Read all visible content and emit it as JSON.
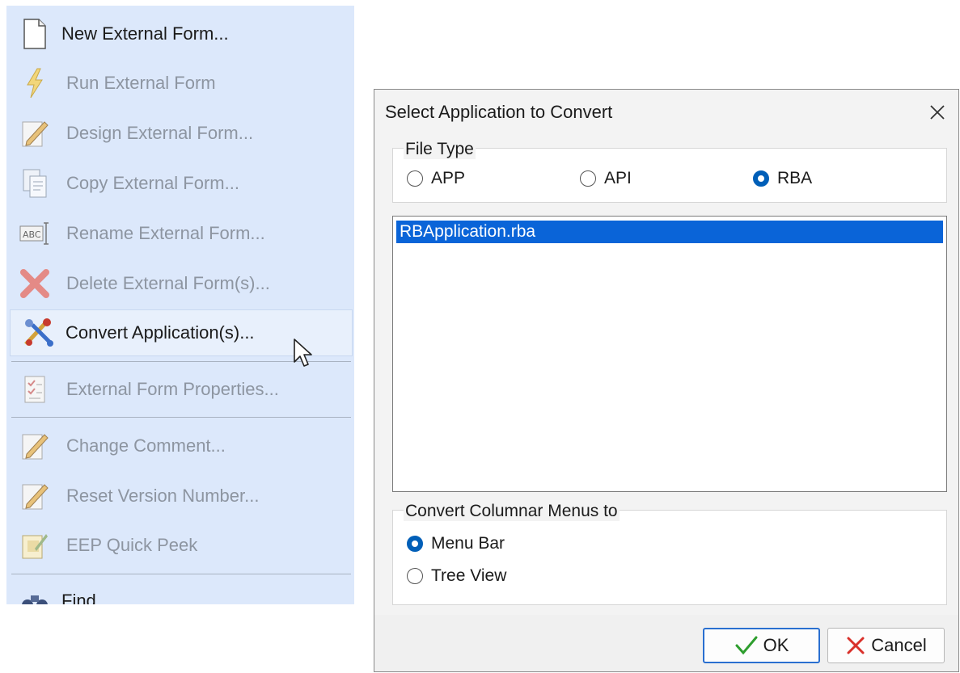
{
  "menu": {
    "items": [
      {
        "label": "New External Form...",
        "icon": "new-document-icon",
        "enabled": true
      },
      {
        "label": "Run External Form",
        "icon": "lightning-bolt-icon",
        "enabled": false
      },
      {
        "label": "Design External Form...",
        "icon": "design-pencil-icon",
        "enabled": false
      },
      {
        "label": "Copy External Form...",
        "icon": "copy-documents-icon",
        "enabled": false
      },
      {
        "label": "Rename External Form...",
        "icon": "rename-abc-icon",
        "enabled": false
      },
      {
        "label": "Delete External Form(s)...",
        "icon": "delete-x-icon",
        "enabled": false
      },
      {
        "label": "Convert Application(s)...",
        "icon": "convert-tools-icon",
        "enabled": true,
        "hovered": true
      },
      {
        "label": "External Form Properties...",
        "icon": "properties-checklist-icon",
        "enabled": false
      },
      {
        "label": "Change Comment...",
        "icon": "comment-pencil-icon",
        "enabled": false
      },
      {
        "label": "Reset Version Number...",
        "icon": "version-pencil-icon",
        "enabled": false
      },
      {
        "label": "EEP Quick Peek",
        "icon": "quick-peek-icon",
        "enabled": false
      },
      {
        "label": "Find...",
        "icon": "binoculars-icon",
        "enabled": true
      }
    ]
  },
  "dialog": {
    "title": "Select Application to Convert",
    "file_type": {
      "label": "File Type",
      "options": [
        {
          "label": "APP",
          "checked": false
        },
        {
          "label": "API",
          "checked": false
        },
        {
          "label": "RBA",
          "checked": true
        }
      ]
    },
    "files": {
      "items": [
        {
          "label": "RBApplication.rba",
          "selected": true
        }
      ]
    },
    "convert_menus": {
      "label": "Convert Columnar Menus to",
      "options": [
        {
          "label": "Menu Bar",
          "checked": true
        },
        {
          "label": "Tree View",
          "checked": false
        }
      ]
    },
    "buttons": {
      "ok": "OK",
      "cancel": "Cancel"
    }
  },
  "colors": {
    "menu_bg": "#dce8fb",
    "selection": "#0a64d8",
    "radio_checked": "#005fb8",
    "ok_check": "#2e9e2e",
    "cancel_x": "#d9302a"
  }
}
